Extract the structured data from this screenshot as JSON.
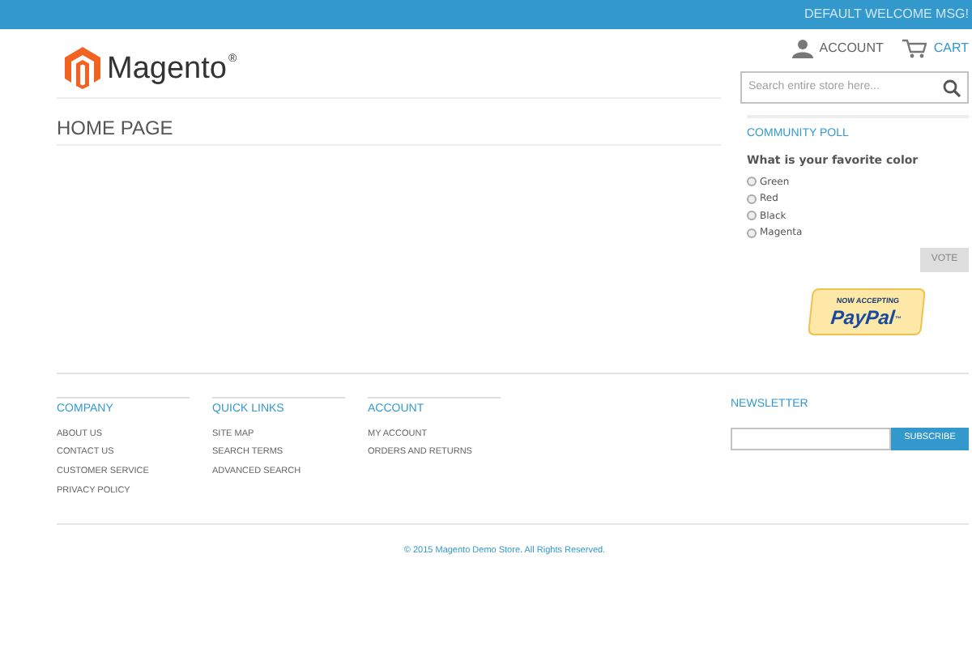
{
  "top_bar": {
    "welcome": "DEFAULT WELCOME MSG!"
  },
  "header": {
    "logo": {
      "name": "Magento",
      "mark": "®"
    },
    "links": [
      {
        "kind": "account",
        "label": "ACCOUNT"
      },
      {
        "kind": "cart",
        "label": "CART"
      }
    ],
    "search": {
      "placeholder": "Search entire store here..."
    }
  },
  "main": {
    "title": "HOME PAGE"
  },
  "poll": {
    "title": "COMMUNITY POLL",
    "question": "What is your favorite color",
    "options": [
      {
        "label": "Green",
        "selected": false
      },
      {
        "label": "Red",
        "selected": false
      },
      {
        "label": "Black",
        "selected": false
      },
      {
        "label": "Magenta",
        "selected": false
      }
    ],
    "button": "VOTE"
  },
  "paypal": {
    "caption": "NOW ACCEPTING",
    "brand": "PayPal",
    "mark": "™"
  },
  "footer": {
    "columns": [
      {
        "title": "COMPANY",
        "links": [
          "ABOUT US",
          "CONTACT US",
          "CUSTOMER SERVICE",
          "PRIVACY POLICY"
        ]
      },
      {
        "title": "QUICK LINKS",
        "links": [
          "SITE MAP",
          "SEARCH TERMS",
          "ADVANCED SEARCH"
        ]
      },
      {
        "title": "ACCOUNT",
        "links": [
          "MY ACCOUNT",
          "ORDERS AND RETURNS"
        ]
      }
    ],
    "newsletter": {
      "title": "NEWSLETTER",
      "button": "SUBSCRIBE"
    },
    "copyright": "© 2015 Magento Demo Store. All Rights Reserved."
  }
}
